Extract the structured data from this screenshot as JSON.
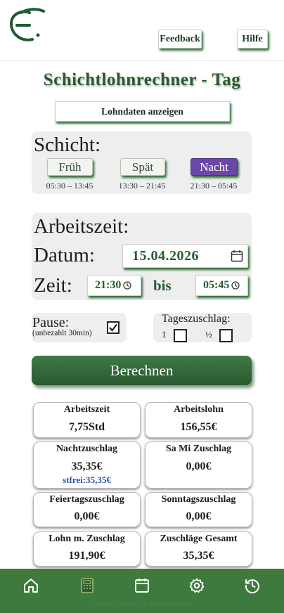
{
  "header": {
    "feedback_label": "Feedback",
    "hilfe_label": "Hilfe"
  },
  "title": "Schichtlohnrechner - Tag",
  "lohndaten_label": "Lohndaten anzeigen",
  "schicht": {
    "title": "Schicht:",
    "shifts": [
      {
        "label": "Früh",
        "time": "05:30 – 13:45"
      },
      {
        "label": "Spät",
        "time": "13:30 – 21:45"
      },
      {
        "label": "Nacht",
        "time": "21:30 – 05:45",
        "selected": true
      }
    ]
  },
  "arbeitszeit": {
    "title": "Arbeitszeit:",
    "datum_label": "Datum:",
    "date_value": "15.04.2026",
    "zeit_label": "Zeit:",
    "start": "21:30",
    "bis_label": "bis",
    "end": "05:45"
  },
  "pause": {
    "label": "Pause:",
    "sub": "(unbezahlt 30min)",
    "checked": true
  },
  "tageszuschlag": {
    "label": "Tageszuschlag:",
    "opt1": "1",
    "opt2": "½"
  },
  "berechnen_label": "Berechnen",
  "results": [
    {
      "title": "Arbeitszeit",
      "value": "7,75Std"
    },
    {
      "title": "Arbeitslohn",
      "value": "156,55€"
    },
    {
      "title": "Nachtzuschlag",
      "value": "35,35€",
      "sub": "stfrei:35,35€"
    },
    {
      "title": "Sa Mi Zuschlag",
      "value": "0,00€"
    },
    {
      "title": "Feiertagszuschlag",
      "value": "0,00€"
    },
    {
      "title": "Sonntagszuschlag",
      "value": "0,00€"
    },
    {
      "title": "Lohn m. Zuschlag",
      "value": "191,90€"
    },
    {
      "title": "Zuschläge Gesamt",
      "value": "35,35€"
    }
  ],
  "footer": {
    "icons": [
      "home-icon",
      "calculator-icon",
      "calendar-icon",
      "gear-icon",
      "history-icon"
    ],
    "copyright": "© 2026 HS-Webdev. Alle Rechte vorbehalten."
  },
  "colors": {
    "brand_green": "#2b5a31",
    "footer_green": "#3e7a3e",
    "accent_purple": "#6b47a8",
    "link_blue": "#2c50a8"
  }
}
